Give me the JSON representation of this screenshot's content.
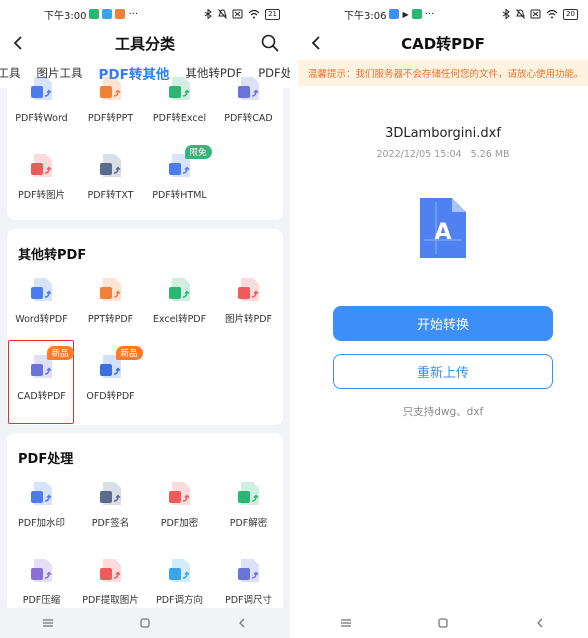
{
  "left_phone": {
    "status": {
      "time": "下午3:00",
      "battery": "21"
    },
    "app_title": "工具分类",
    "tabs": [
      "码工具",
      "图片工具",
      "PDF转其他",
      "其他转PDF",
      "PDF处理"
    ],
    "active_tab_index": 2,
    "pdf_to_other": {
      "items": [
        {
          "label": "PDF转Word",
          "color": "#4b7bec"
        },
        {
          "label": "PDF转PPT",
          "color": "#f0813a"
        },
        {
          "label": "PDF转Excel",
          "color": "#2bb673"
        },
        {
          "label": "PDF转CAD",
          "color": "#6a73d8"
        },
        {
          "label": "PDF转图片",
          "color": "#ef5b5b"
        },
        {
          "label": "PDF转TXT",
          "color": "#5a6b8c"
        },
        {
          "label": "PDF转HTML",
          "color": "#4b7bec",
          "badge": "限免"
        }
      ]
    },
    "other_to_pdf": {
      "title": "其他转PDF",
      "items": [
        {
          "label": "Word转PDF",
          "color": "#4b7bec"
        },
        {
          "label": "PPT转PDF",
          "color": "#f0813a"
        },
        {
          "label": "Excel转PDF",
          "color": "#2bb673"
        },
        {
          "label": "图片转PDF",
          "color": "#ef5b5b"
        },
        {
          "label": "CAD转PDF",
          "color": "#6a73d8",
          "badge": "新品",
          "highlighted": true
        },
        {
          "label": "OFD转PDF",
          "color": "#3d6fe0",
          "badge": "新品"
        }
      ]
    },
    "pdf_process": {
      "title": "PDF处理",
      "items": [
        {
          "label": "PDF加水印",
          "color": "#4b7bec"
        },
        {
          "label": "PDF签名",
          "color": "#5a6b8c"
        },
        {
          "label": "PDF加密",
          "color": "#ef5b5b"
        },
        {
          "label": "PDF解密",
          "color": "#2bb673"
        },
        {
          "label": "PDF压缩",
          "color": "#8a6fd8"
        },
        {
          "label": "PDF提取图片",
          "color": "#ef5b5b"
        },
        {
          "label": "PDF调方向",
          "color": "#3aa4e8"
        },
        {
          "label": "PDF调尺寸",
          "color": "#6a73d8"
        }
      ]
    }
  },
  "right_phone": {
    "status": {
      "time": "下午3:06",
      "battery": "20"
    },
    "app_title": "CAD转PDF",
    "warning": "温馨提示：我们服务器不会存储任何您的文件，请放心使用功能。",
    "file": {
      "name": "3DLamborgini.dxf",
      "date": "2022/12/05 15:04",
      "size": "5.26 MB",
      "icon_letter": "A"
    },
    "start_button": "开始转换",
    "reupload_button": "重新上传",
    "support_text": "只支持dwg、dxf"
  },
  "colors": {
    "accent": "#2f7cf6",
    "button": "#3d8ef7",
    "warning_bg": "#fdf3e0",
    "warning_text": "#e8722e",
    "badge_new": "#ff7a29",
    "badge_free": "#35b57a",
    "highlight": "#e2312e"
  }
}
